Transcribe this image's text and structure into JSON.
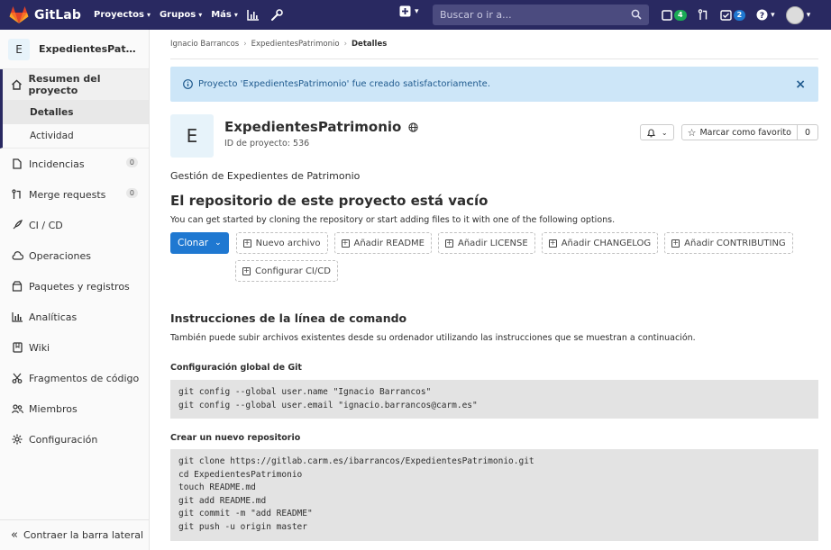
{
  "topbar": {
    "brand": "GitLab",
    "nav": [
      "Proyectos",
      "Grupos",
      "Más"
    ],
    "search_placeholder": "Buscar o ir a...",
    "todos_count": "4",
    "issues_count": "2"
  },
  "sidebar": {
    "project_initial": "E",
    "project_name": "ExpedientesPatrimonio",
    "overview": "Resumen del proyecto",
    "sub_items": [
      "Detalles",
      "Actividad"
    ],
    "items": [
      {
        "label": "Incidencias",
        "count": "0"
      },
      {
        "label": "Merge requests",
        "count": "0"
      },
      {
        "label": "CI / CD"
      },
      {
        "label": "Operaciones"
      },
      {
        "label": "Paquetes y registros"
      },
      {
        "label": "Analíticas"
      },
      {
        "label": "Wiki"
      },
      {
        "label": "Fragmentos de código"
      },
      {
        "label": "Miembros"
      },
      {
        "label": "Configuración"
      }
    ],
    "collapse": "Contraer la barra lateral"
  },
  "breadcrumb": [
    "Ignacio Barrancos",
    "ExpedientesPatrimonio",
    "Detalles"
  ],
  "alert": "Proyecto 'ExpedientesPatrimonio' fue creado satisfactoriamente.",
  "project": {
    "initial": "E",
    "name": "ExpedientesPatrimonio",
    "id_text": "ID de proyecto: 536",
    "star_label": "Marcar como favorito",
    "star_count": "0",
    "description": "Gestión de Expedientes de Patrimonio"
  },
  "empty": {
    "title": "El repositorio de este proyecto está vacío",
    "subtitle": "You can get started by cloning the repository or start adding files to it with one of the following options.",
    "clone_label": "Clonar",
    "buttons": [
      "Nuevo archivo",
      "Añadir README",
      "Añadir LICENSE",
      "Añadir CHANGELOG",
      "Añadir CONTRIBUTING",
      "Configurar CI/CD"
    ]
  },
  "instructions": {
    "title": "Instrucciones de la línea de comando",
    "subtitle": "También puede subir archivos existentes desde su ordenador utilizando las instrucciones que se muestran a continuación.",
    "global_title": "Configuración global de Git",
    "global_lines": [
      "git config --global user.name \"Ignacio Barrancos\"",
      "git config --global user.email \"ignacio.barrancos@carm.es\""
    ],
    "new_repo_title": "Crear un nuevo repositorio",
    "new_repo_lines": [
      "git clone https://gitlab.carm.es/ibarrancos/ExpedientesPatrimonio.git",
      "cd ExpedientesPatrimonio",
      "touch README.md",
      "git add README.md",
      "git commit -m \"add README\"",
      "git push -u origin master"
    ]
  },
  "colors": {
    "navbar": "#292961",
    "primary": "#1f78d1",
    "alert_bg": "#cde6f8"
  }
}
